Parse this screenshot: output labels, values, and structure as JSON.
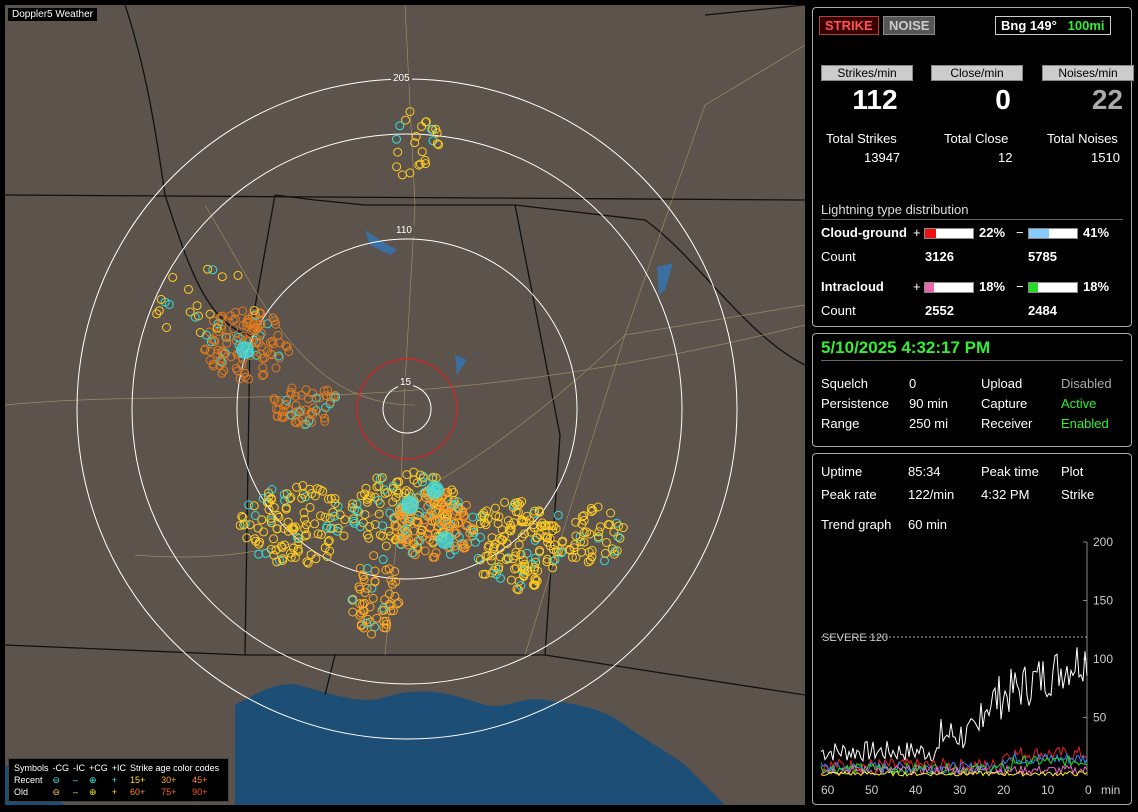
{
  "map": {
    "title": "Doppler5 Weather",
    "ring_labels": [
      "205",
      "110",
      "15"
    ],
    "legend": {
      "symbols_label": "Symbols",
      "columns": [
        "-CG",
        "-IC",
        "+CG",
        "+IC"
      ],
      "recent_label": "Recent",
      "old_label": "Old",
      "age_title": "Strike age color codes",
      "recent_ages": [
        "15+",
        "30+",
        "45+"
      ],
      "old_ages": [
        "60+",
        "75+",
        "90+"
      ]
    }
  },
  "status": {
    "strike_btn": "STRIKE",
    "noise_btn": "NOISE",
    "bearing": "Bng 149°",
    "range": "100mi",
    "strikes_per_min_label": "Strikes/min",
    "close_per_min_label": "Close/min",
    "noises_per_min_label": "Noises/min",
    "strikes_per_min": "112",
    "close_per_min": "0",
    "noises_per_min": "22",
    "total_strikes_label": "Total Strikes",
    "total_close_label": "Total Close",
    "total_noises_label": "Total Noises",
    "total_strikes": "13947",
    "total_close": "12",
    "total_noises": "1510"
  },
  "distribution": {
    "title": "Lightning type distribution",
    "cg_label": "Cloud-ground",
    "ic_label": "Intracloud",
    "count_label": "Count",
    "plus": "+",
    "minus": "−",
    "cg_pos_pct": "22%",
    "cg_neg_pct": "41%",
    "cg_pos_count": "3126",
    "cg_neg_count": "5785",
    "ic_pos_pct": "18%",
    "ic_neg_pct": "18%",
    "ic_pos_count": "2552",
    "ic_neg_count": "2484",
    "cg_pos_fraction": 0.22,
    "cg_neg_fraction": 0.41,
    "ic_pos_fraction": 0.18,
    "ic_neg_fraction": 0.18,
    "colors": {
      "cg_pos": "#ee1111",
      "cg_neg": "#88ccff",
      "ic_pos": "#ee66aa",
      "ic_neg": "#22dd22"
    }
  },
  "settings": {
    "datetime": "5/10/2025 4:32:17 PM",
    "squelch_label": "Squelch",
    "squelch": "0",
    "persistence_label": "Persistence",
    "persistence": "90 min",
    "range_label": "Range",
    "range": "250 mi",
    "upload_label": "Upload",
    "upload": "Disabled",
    "capture_label": "Capture",
    "capture": "Active",
    "receiver_label": "Receiver",
    "receiver": "Enabled"
  },
  "trend": {
    "uptime_label": "Uptime",
    "uptime": "85:34",
    "peak_time_label": "Peak time",
    "peak_time": "4:32 PM",
    "plot_label": "Plot",
    "plot": "Strike",
    "peak_rate_label": "Peak rate",
    "peak_rate": "122/min",
    "trend_label": "Trend graph",
    "trend": "60 min",
    "severe_label": "SEVERE 120",
    "y_ticks": [
      "200",
      "150",
      "100",
      "50"
    ],
    "x_ticks": [
      "60",
      "50",
      "40",
      "30",
      "20",
      "10",
      "0"
    ],
    "x_unit": "min"
  }
}
